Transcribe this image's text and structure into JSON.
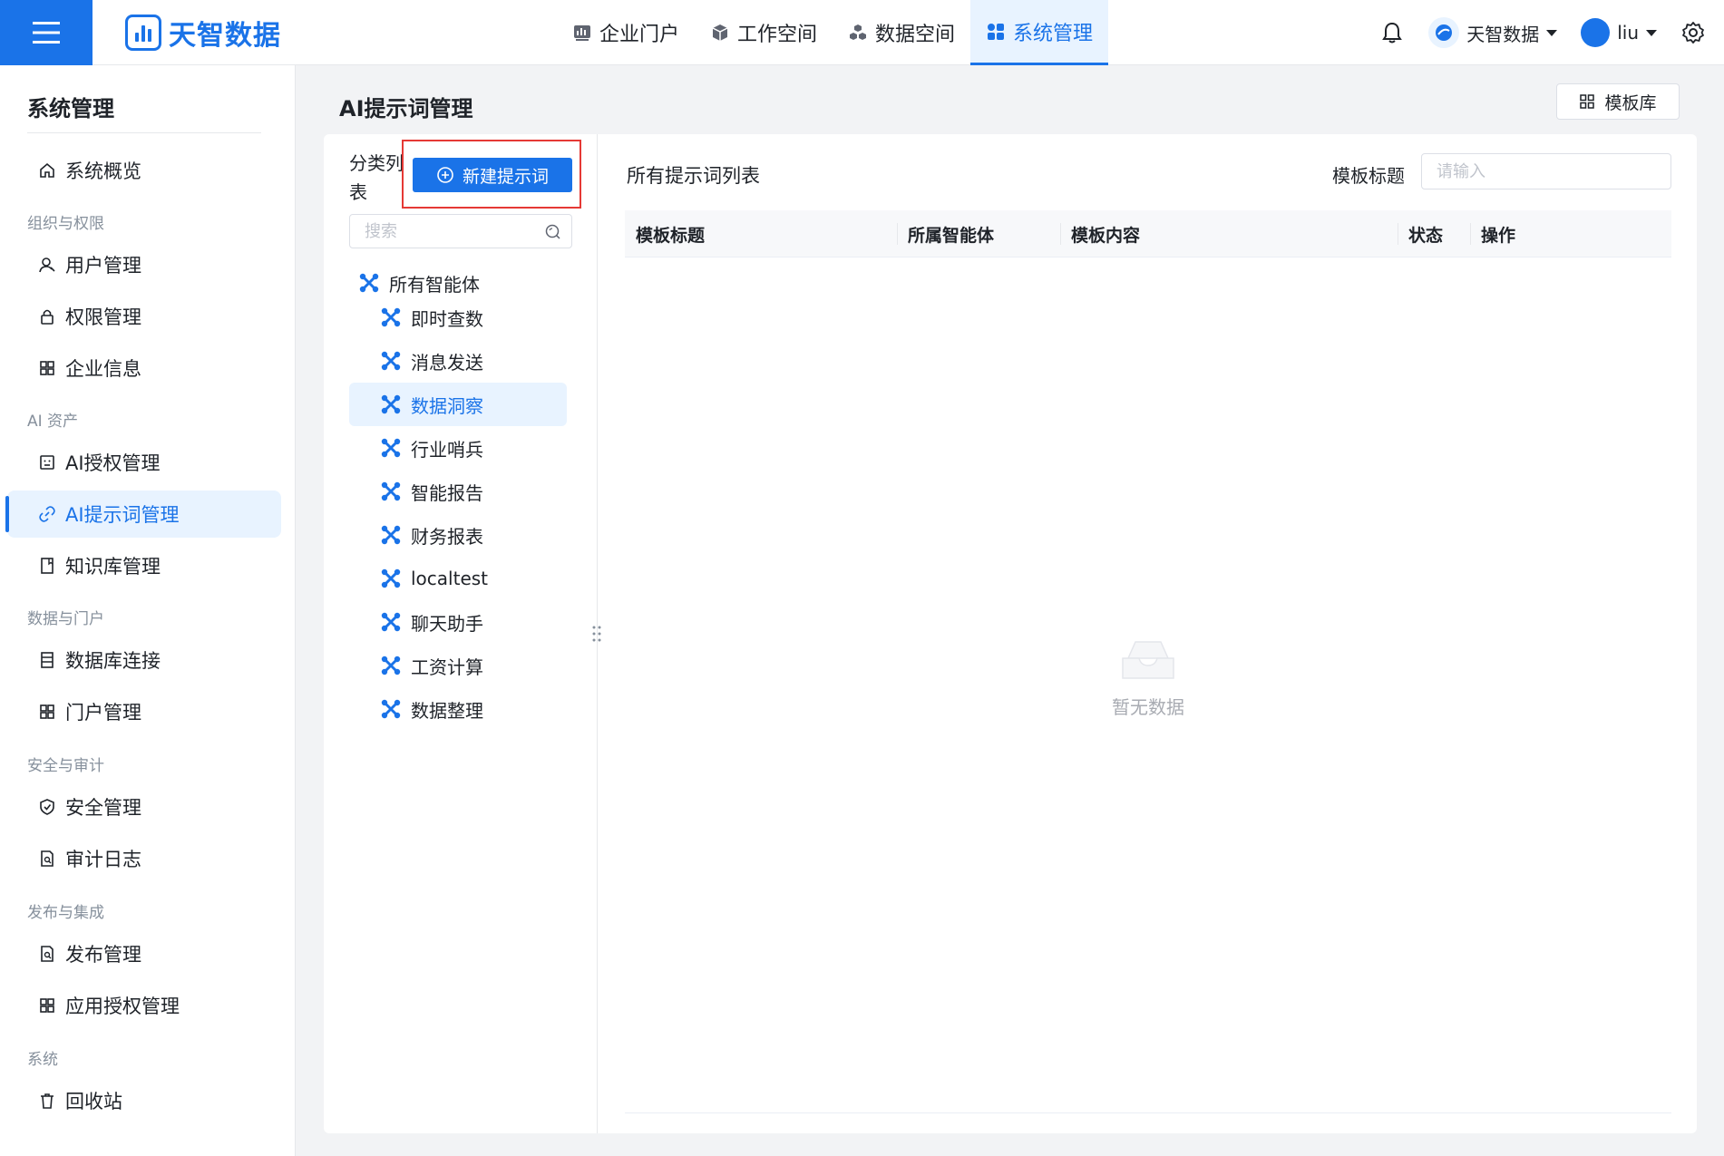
{
  "topbar": {
    "brand": "天智数据",
    "nav": [
      {
        "label": "企业门户",
        "icon": "dashboard-icon"
      },
      {
        "label": "工作空间",
        "icon": "cube-icon"
      },
      {
        "label": "数据空间",
        "icon": "cubes-icon"
      },
      {
        "label": "系统管理",
        "icon": "grid-icon",
        "active": true
      }
    ],
    "org_name": "天智数据",
    "user_name": "liu"
  },
  "sidebar": {
    "title": "系统管理",
    "overview": "系统概览",
    "groups": [
      {
        "label": "组织与权限",
        "items": [
          "用户管理",
          "权限管理",
          "企业信息"
        ]
      },
      {
        "label": "AI 资产",
        "items": [
          "AI授权管理",
          "AI提示词管理",
          "知识库管理"
        ]
      },
      {
        "label": "数据与门户",
        "items": [
          "数据库连接",
          "门户管理"
        ]
      },
      {
        "label": "安全与审计",
        "items": [
          "安全管理",
          "审计日志"
        ]
      },
      {
        "label": "发布与集成",
        "items": [
          "发布管理",
          "应用授权管理"
        ]
      },
      {
        "label": "系统",
        "items": [
          "回收站"
        ]
      }
    ],
    "active_item": "AI提示词管理"
  },
  "page": {
    "title": "AI提示词管理",
    "template_library_label": "模板库"
  },
  "category_panel": {
    "title": "分类列表",
    "new_button_label": "新建提示词",
    "search_placeholder": "搜索",
    "root": "所有智能体",
    "children": [
      "即时查数",
      "消息发送",
      "数据洞察",
      "行业哨兵",
      "智能报告",
      "财务报表",
      "localtest",
      "聊天助手",
      "工资计算",
      "数据整理"
    ],
    "active_child": "数据洞察"
  },
  "list_panel": {
    "title": "所有提示词列表",
    "filter_label": "模板标题",
    "filter_placeholder": "请输入",
    "columns": [
      "模板标题",
      "所属智能体",
      "模板内容",
      "状态",
      "操作"
    ],
    "empty_text": "暂无数据"
  },
  "colors": {
    "primary": "#1a73e8",
    "highlight_outline": "#e53935",
    "active_bg": "#e8f3ff"
  }
}
